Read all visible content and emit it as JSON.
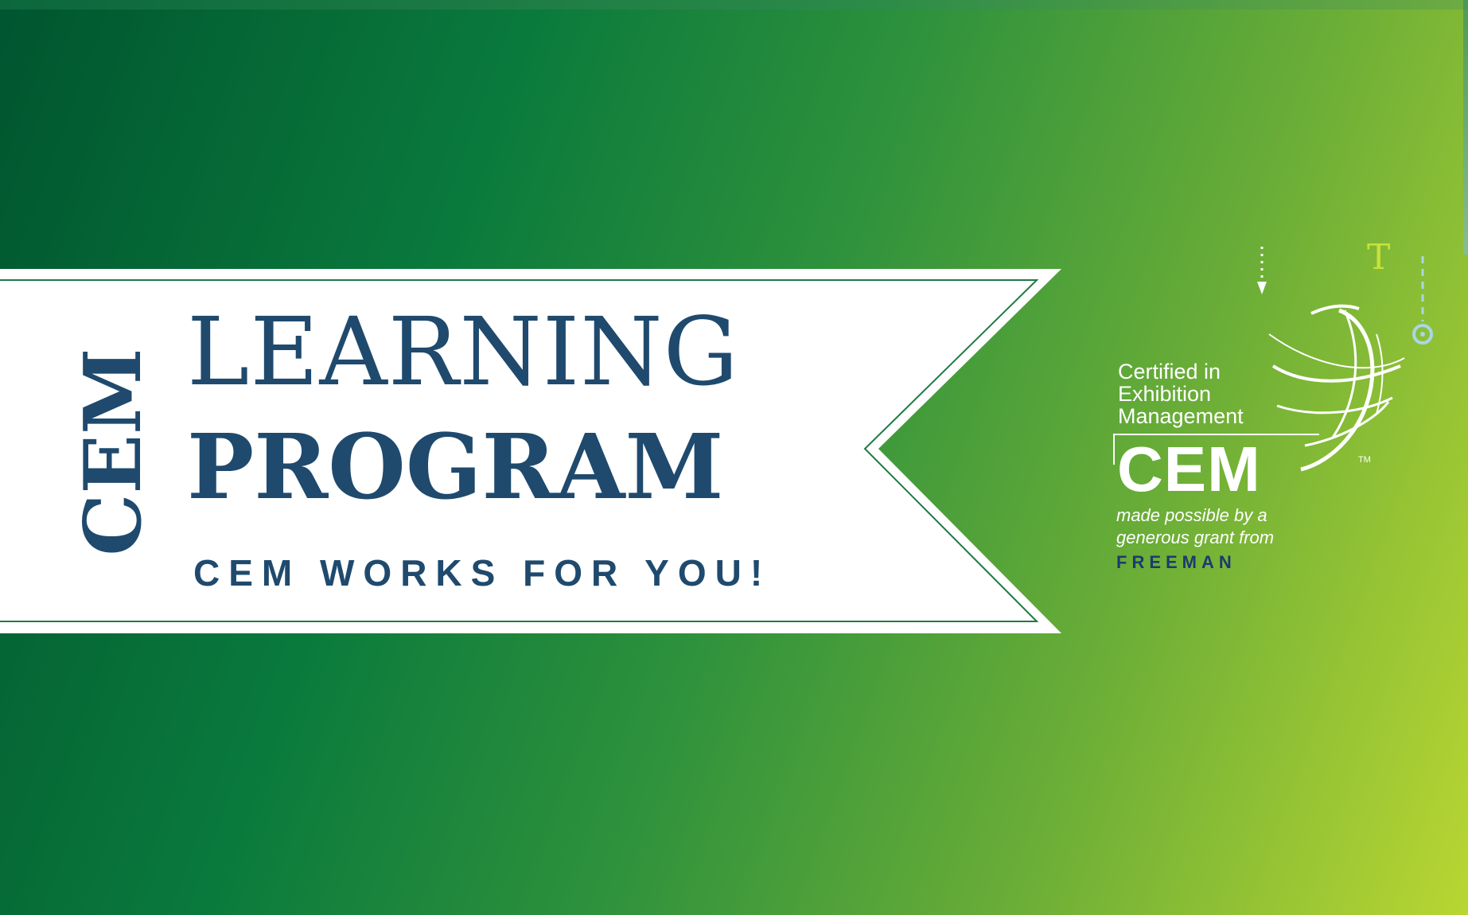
{
  "banner": {
    "vertical_text": "CEM",
    "title_line1": "LEARNING",
    "title_line2": "PROGRAM",
    "tagline": "CEM WORKS FOR YOU!"
  },
  "logo": {
    "line1": "Certified in",
    "line2": "Exhibition",
    "line3": "Management",
    "acronym": "CEM",
    "trademark": "TM",
    "credit_line1": "made possible by a",
    "credit_line2": "generous grant from",
    "sponsor": "FREEMAN"
  },
  "decorations": {
    "t_glyph": "T"
  },
  "colors": {
    "navy_text": "#1f4a6e",
    "banner_fill": "#ffffff",
    "banner_outline": "#1e7a45",
    "gradient_dark": "#00552f",
    "gradient_light": "#b9d632",
    "sponsor_blue": "#1b3a70"
  },
  "icons": {
    "globe": "globe-swoosh-icon",
    "arrow": "dotted-down-arrow-icon",
    "pin": "dashed-pin-icon"
  }
}
